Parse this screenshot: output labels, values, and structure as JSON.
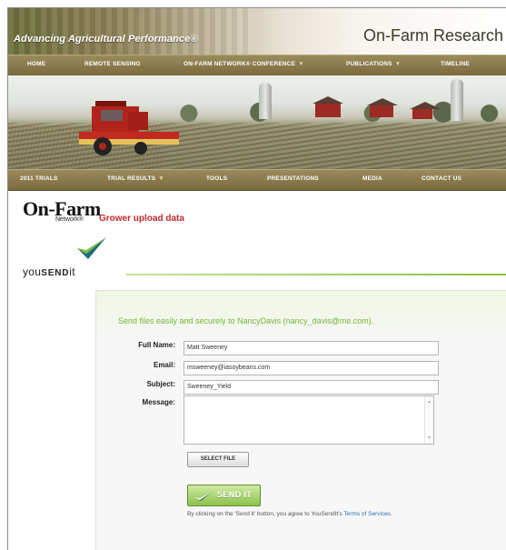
{
  "header": {
    "tagline": "Advancing Agricultural Performance®",
    "site_title": "On-Farm Research"
  },
  "top_nav": [
    {
      "label": "HOME"
    },
    {
      "label": "REMOTE SENSING"
    },
    {
      "label": "ON-FARM NETWORK® CONFERENCE",
      "dropdown": true
    },
    {
      "label": "PUBLICATIONS",
      "dropdown": true
    },
    {
      "label": "TIMELINE"
    }
  ],
  "bottom_nav": [
    {
      "label": "2011 TRIALS"
    },
    {
      "label": "TRIAL RESULTS",
      "dropdown": true
    },
    {
      "label": "TOOLS"
    },
    {
      "label": "PRESENTATIONS"
    },
    {
      "label": "MEDIA"
    },
    {
      "label": "CONTACT US"
    }
  ],
  "logos": {
    "onfarm_word": "On-Farm",
    "onfarm_sub": "Network®",
    "yousendit_a": "you",
    "yousendit_b": "SEND",
    "yousendit_c": "it"
  },
  "page_title": "Grower upload data",
  "form": {
    "send_to": "Send files easily and securely to NancyDavis (nancy_davis@me.com).",
    "full_name_label": "Full Name:",
    "full_name_value": "Matt Sweeney",
    "email_label": "Email:",
    "email_value": "msweeney@iasoybeans.com",
    "subject_label": "Subject:",
    "subject_value": "Sweeney_Yield",
    "message_label": "Message:",
    "message_value": "",
    "select_file_label": "SELECT FILE",
    "send_label": "SEND IT",
    "agreement_text": "By clicking on the 'Send it' button, you agree to YouSendIt's",
    "terms_link": "Terms of Services."
  },
  "colors": {
    "nav_bg": "#8a7a4c",
    "accent_green": "#76b43a",
    "title_red": "#c1272d"
  }
}
